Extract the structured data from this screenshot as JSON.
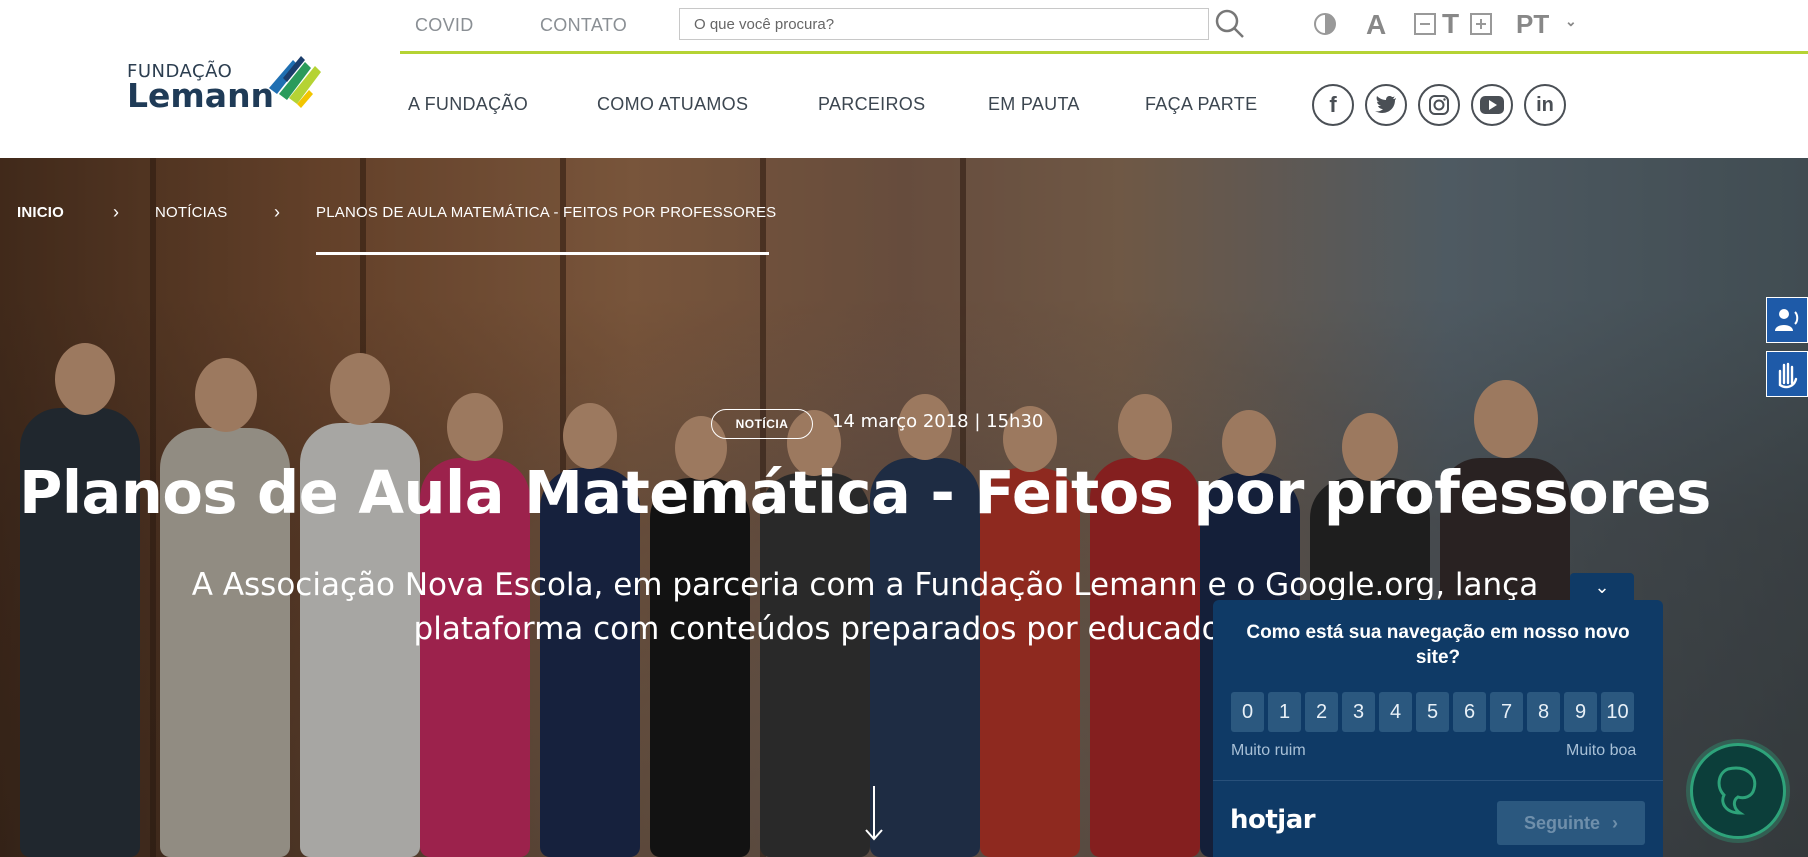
{
  "brand": {
    "line1": "FUNDAÇÃO",
    "line2": "Lemann"
  },
  "top_links": [
    "COVID",
    "CONTATO"
  ],
  "search": {
    "placeholder": "O que você procura?"
  },
  "accessibility": {
    "font_a": "A",
    "font_t": "T",
    "language": "PT"
  },
  "main_nav": [
    "A FUNDAÇÃO",
    "COMO ATUAMOS",
    "PARCEIROS",
    "EM PAUTA",
    "FAÇA PARTE"
  ],
  "social_icons": [
    "facebook-icon",
    "twitter-icon",
    "instagram-icon",
    "youtube-icon",
    "linkedin-icon"
  ],
  "breadcrumb": [
    "INICIO",
    "NOTÍCIAS",
    "PLANOS DE AULA MATEMÁTICA - FEITOS POR PROFESSORES"
  ],
  "article": {
    "badge": "NOTÍCIA",
    "date": "14 março 2018 | 15h30",
    "title": "Planos de Aula Matemática - Feitos por professores",
    "subtitle_line1": "A Associação Nova Escola, em parceria com a Fundação Lemann e o Google.org, lança",
    "subtitle_line2": "plataforma com conteúdos preparados por educadores de"
  },
  "hotjar": {
    "question": "Como está sua navegação em nosso novo site?",
    "scale": [
      "0",
      "1",
      "2",
      "3",
      "4",
      "5",
      "6",
      "7",
      "8",
      "9",
      "10"
    ],
    "low_label": "Muito ruim",
    "high_label": "Muito boa",
    "logo": "hotjar",
    "next_label": "Seguinte"
  },
  "colors": {
    "accent_green": "#b5d334",
    "survey_bg": "#0f3a66",
    "vlibras_blue": "#1e5aa8"
  }
}
